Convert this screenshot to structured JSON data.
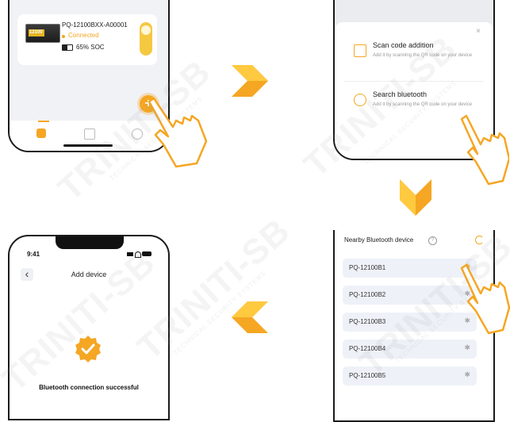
{
  "panel1": {
    "device_name": "PQ-12100BXX-A00001",
    "status": "Connected",
    "soc": "65% SOC",
    "battery_label": "12100 "
  },
  "panel2": {
    "close_glyph": "×",
    "scan": {
      "title": "Scan code addition",
      "desc": "Add it by scanning the QR code on your device"
    },
    "search": {
      "title": "Search bluetooth",
      "desc": "Add it by scanning the QR code on your device"
    }
  },
  "panel3": {
    "time": "9:41",
    "back_glyph": "‹",
    "title": "Add device",
    "success_text": "Bluetooth connection successful"
  },
  "panel4": {
    "header": "Nearby Bluetooth device",
    "devices": [
      "PQ-12100B1",
      "PQ-12100B2",
      "PQ-12100B3",
      "PQ-12100B4",
      "PQ-12100B5"
    ]
  },
  "watermark": {
    "brand": "TRINITI-SB",
    "tagline": "TECHNICAL SECURITY SYSTEMS"
  },
  "colors": {
    "accent": "#f5a623",
    "arrow_dark": "#f08a00",
    "arrow_light": "#ffc940"
  }
}
